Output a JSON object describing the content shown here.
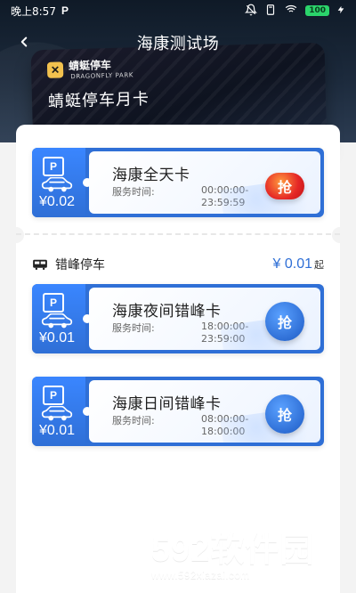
{
  "statusbar": {
    "time": "晚上8:57",
    "app_mark": "P",
    "battery": "100"
  },
  "header": {
    "title": "海康测试场"
  },
  "month_card": {
    "brand_cn": "蜻蜓停车",
    "brand_en": "DRAGONFLY PARK",
    "name": "蜻蜓停车月卡"
  },
  "tickets": [
    {
      "name": "海康全天卡",
      "time_label": "服务时间:",
      "time_start": "00:00:00-",
      "time_end": "23:59:59",
      "price": "¥0.02",
      "button": "抢",
      "button_color": "#e52626"
    },
    {
      "name": "海康夜间错峰卡",
      "time_label": "服务时间:",
      "time_start": "18:00:00-",
      "time_end": "23:59:00",
      "price": "¥0.01",
      "button": "抢",
      "button_color": "#2f6fd6"
    },
    {
      "name": "海康日间错峰卡",
      "time_label": "服务时间:",
      "time_start": "08:00:00-",
      "time_end": "18:00:00",
      "price": "¥0.01",
      "button": "抢",
      "button_color": "#2f6fd6"
    }
  ],
  "section": {
    "title": "错峰停车",
    "price": "¥ 0.01",
    "price_suffix": "起"
  },
  "watermark": {
    "top": "592软件园",
    "bottom": "www.592xiazai.com"
  },
  "colors": {
    "primary_blue": "#2f6fd6",
    "accent_red": "#e52626"
  }
}
